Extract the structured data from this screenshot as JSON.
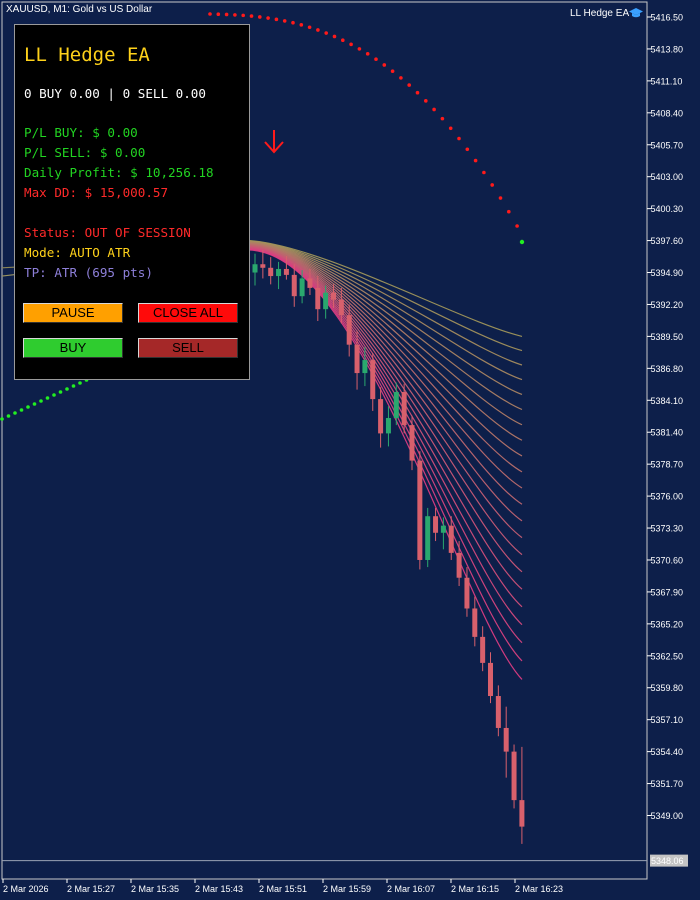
{
  "window": {
    "symbol_title": "XAUUSD, M1:  Gold vs US Dollar",
    "ea_label": "LL Hedge EA"
  },
  "panel": {
    "title": "LL Hedge EA",
    "positions": "0 BUY 0.00 | 0 SELL 0.00",
    "pl_buy": "P/L BUY: $ 0.00",
    "pl_sell": "P/L SELL: $ 0.00",
    "daily_profit": "Daily Profit: $ 10,256.18",
    "max_dd": "Max DD: $ 15,000.57",
    "status": "Status: OUT OF SESSION",
    "mode": "Mode: AUTO ATR",
    "tp": "TP: ATR (695 pts)",
    "buttons": {
      "pause": "PAUSE",
      "close_all": "CLOSE ALL",
      "buy": "BUY",
      "sell": "SELL"
    }
  },
  "colors": {
    "background": "#0d1f4a",
    "panel_title": "#ffd21a",
    "profit_green": "#22d422",
    "loss_red": "#ff2a2a",
    "tp_purple": "#8d7fd8",
    "pause_btn": "#ffa000",
    "close_btn": "#ff0a0a",
    "buy_btn": "#2fcc2f",
    "sell_btn": "#a52828",
    "bull_candle": "#2aa86e",
    "bear_candle": "#d8606c"
  },
  "chart_data": {
    "type": "candlestick",
    "symbol": "XAUUSD",
    "timeframe": "M1",
    "current_price": "5348.06",
    "ylim": [
      5346.4,
      5417.9
    ],
    "price_ticks": [
      "5416.50",
      "5413.80",
      "5411.10",
      "5408.40",
      "5405.70",
      "5403.00",
      "5400.30",
      "5397.60",
      "5394.90",
      "5392.20",
      "5389.50",
      "5386.80",
      "5384.10",
      "5381.40",
      "5378.70",
      "5376.00",
      "5373.30",
      "5370.60",
      "5367.90",
      "5365.20",
      "5362.50",
      "5359.80",
      "5357.10",
      "5354.40",
      "5351.70",
      "5349.00"
    ],
    "time_ticks": [
      "2 Mar 2026",
      "2 Mar 15:27",
      "2 Mar 15:35",
      "2 Mar 15:43",
      "2 Mar 15:51",
      "2 Mar 15:59",
      "2 Mar 16:07",
      "2 Mar 16:15",
      "2 Mar 16:23"
    ],
    "candles_ohlc": [
      [
        5394.9,
        5396.5,
        5393.8,
        5395.6
      ],
      [
        5395.6,
        5396.8,
        5394.4,
        5395.3
      ],
      [
        5395.3,
        5396.2,
        5393.9,
        5394.6
      ],
      [
        5394.6,
        5395.8,
        5393.5,
        5395.2
      ],
      [
        5395.2,
        5396.3,
        5394.3,
        5394.7
      ],
      [
        5394.7,
        5395.6,
        5392.0,
        5392.9
      ],
      [
        5392.9,
        5395.1,
        5392.3,
        5394.4
      ],
      [
        5394.4,
        5395.2,
        5393.0,
        5393.6
      ],
      [
        5393.6,
        5394.6,
        5390.8,
        5391.8
      ],
      [
        5391.8,
        5393.8,
        5391.0,
        5393.2
      ],
      [
        5393.2,
        5393.9,
        5391.9,
        5392.6
      ],
      [
        5392.6,
        5393.6,
        5390.6,
        5391.3
      ],
      [
        5391.3,
        5392.2,
        5387.8,
        5388.8
      ],
      [
        5388.8,
        5390.0,
        5385.0,
        5386.4
      ],
      [
        5386.4,
        5388.6,
        5385.3,
        5387.5
      ],
      [
        5387.5,
        5388.1,
        5383.2,
        5384.2
      ],
      [
        5384.2,
        5385.2,
        5380.1,
        5381.3
      ],
      [
        5381.3,
        5383.6,
        5380.2,
        5382.6
      ],
      [
        5382.6,
        5385.6,
        5382.0,
        5384.8
      ],
      [
        5384.8,
        5385.5,
        5381.3,
        5382.0
      ],
      [
        5382.0,
        5382.8,
        5378.2,
        5379.0
      ],
      [
        5379.0,
        5379.8,
        5369.8,
        5370.6
      ],
      [
        5370.6,
        5375.0,
        5370.0,
        5374.3
      ],
      [
        5374.3,
        5375.0,
        5372.2,
        5372.9
      ],
      [
        5372.9,
        5374.2,
        5371.5,
        5373.5
      ],
      [
        5373.5,
        5374.3,
        5370.6,
        5371.2
      ],
      [
        5371.2,
        5372.2,
        5368.4,
        5369.1
      ],
      [
        5369.1,
        5370.0,
        5365.8,
        5366.5
      ],
      [
        5366.5,
        5367.5,
        5363.3,
        5364.1
      ],
      [
        5364.1,
        5365.0,
        5361.2,
        5361.9
      ],
      [
        5361.9,
        5362.8,
        5358.5,
        5359.1
      ],
      [
        5359.1,
        5360.0,
        5355.7,
        5356.4
      ],
      [
        5356.4,
        5358.2,
        5352.2,
        5354.4
      ],
      [
        5354.4,
        5355.0,
        5349.6,
        5350.3
      ],
      [
        5350.3,
        5354.8,
        5346.6,
        5348.06
      ]
    ]
  }
}
